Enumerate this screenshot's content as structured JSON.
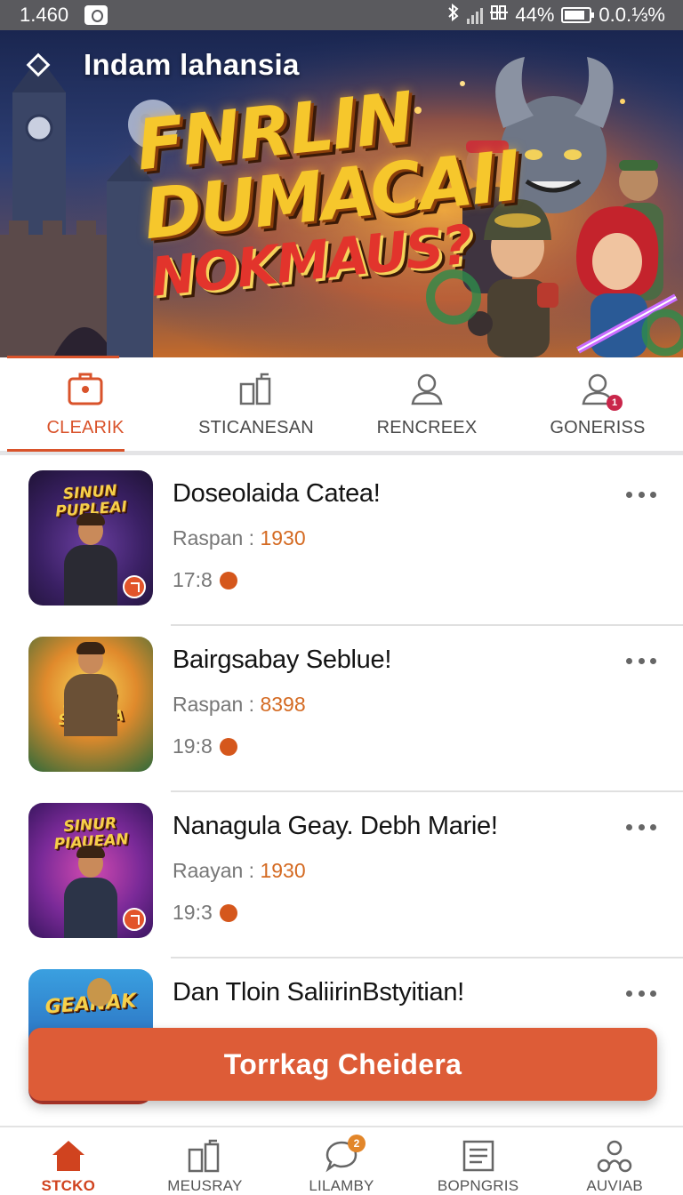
{
  "status_bar": {
    "time": "1.460",
    "battery": "44%",
    "data_rate": "0.0.⅓%"
  },
  "header": {
    "title": "Indam lahansia"
  },
  "hero": {
    "line1": "FNRLIN",
    "line2": "DUMACAII",
    "line3": "NOKMAUS?"
  },
  "tabs": [
    {
      "label": "CLEARIK",
      "icon": "briefcase-icon",
      "active": true
    },
    {
      "label": "STICANESAN",
      "icon": "buildings-icon",
      "active": false
    },
    {
      "label": "RENCREEX",
      "icon": "person-icon",
      "active": false
    },
    {
      "label": "GONERISS",
      "icon": "person-badge-icon",
      "active": false,
      "badge": "1"
    }
  ],
  "games": [
    {
      "title": "Doseolaida Catea!",
      "meta_label": "Raspan :",
      "meta_value": "1930",
      "time": "17:8",
      "thumb_text": "SINUN PUPLEAI"
    },
    {
      "title": "Bairgsabay Seblue!",
      "meta_label": "Raspan :",
      "meta_value": "8398",
      "time": "19:8",
      "thumb_text": "SIMIAI SUPELA"
    },
    {
      "title": "Nanagula Geay. Debh Marie!",
      "meta_label": "Raayan :",
      "meta_value": "1930",
      "time": "19:3",
      "thumb_text": "SINUR PIAUEAN"
    },
    {
      "title": "Dan Tloin SaliirinBstyitian!",
      "meta_label": "",
      "meta_value": "",
      "time": "",
      "thumb_text": "GEANAK"
    }
  ],
  "cta": {
    "label": "Torrkag Cheidera"
  },
  "bottom_nav": [
    {
      "label": "STCKO",
      "icon": "home-icon",
      "active": true
    },
    {
      "label": "MEUSRAY",
      "icon": "buildings-icon",
      "active": false
    },
    {
      "label": "LILAMBY",
      "icon": "chat-bubble-icon",
      "active": false,
      "badge": "2"
    },
    {
      "label": "BOPNGRIS",
      "icon": "list-icon",
      "active": false
    },
    {
      "label": "AUVIAB",
      "icon": "people-network-icon",
      "active": false
    }
  ],
  "colors": {
    "accent": "#d9532b",
    "cta": "#dd5c37",
    "value_orange": "#d46a22"
  }
}
